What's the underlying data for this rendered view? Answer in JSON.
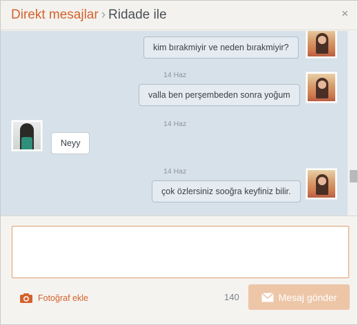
{
  "header": {
    "title_link": "Direkt mesajlar",
    "title_separator": "›",
    "title_user": "Ridade ile",
    "close_symbol": "×"
  },
  "messages": [
    {
      "sender": "me",
      "timestamp": "",
      "text": "kim bırakmiyir ve neden bırakmiyir?"
    },
    {
      "sender": "me",
      "timestamp": "14 Haz",
      "text": "valla ben perşembeden sonra yoğum"
    },
    {
      "sender": "other",
      "timestamp": "14 Haz",
      "text": "Neyy"
    },
    {
      "sender": "me",
      "timestamp": "14 Haz",
      "text": "çok özlersiniz sooğra keyfiniz bilir."
    }
  ],
  "composer": {
    "input_value": "",
    "photo_label": "Fotoğraf ekle",
    "char_count": "140",
    "send_label": "Mesaj gönder"
  },
  "icons": {
    "camera": "camera-icon",
    "envelope": "envelope-icon",
    "close": "close-icon"
  },
  "colors": {
    "accent": "#d4622c",
    "send_button_disabled": "#edc6a8",
    "messages_background": "#d7e1e9"
  }
}
